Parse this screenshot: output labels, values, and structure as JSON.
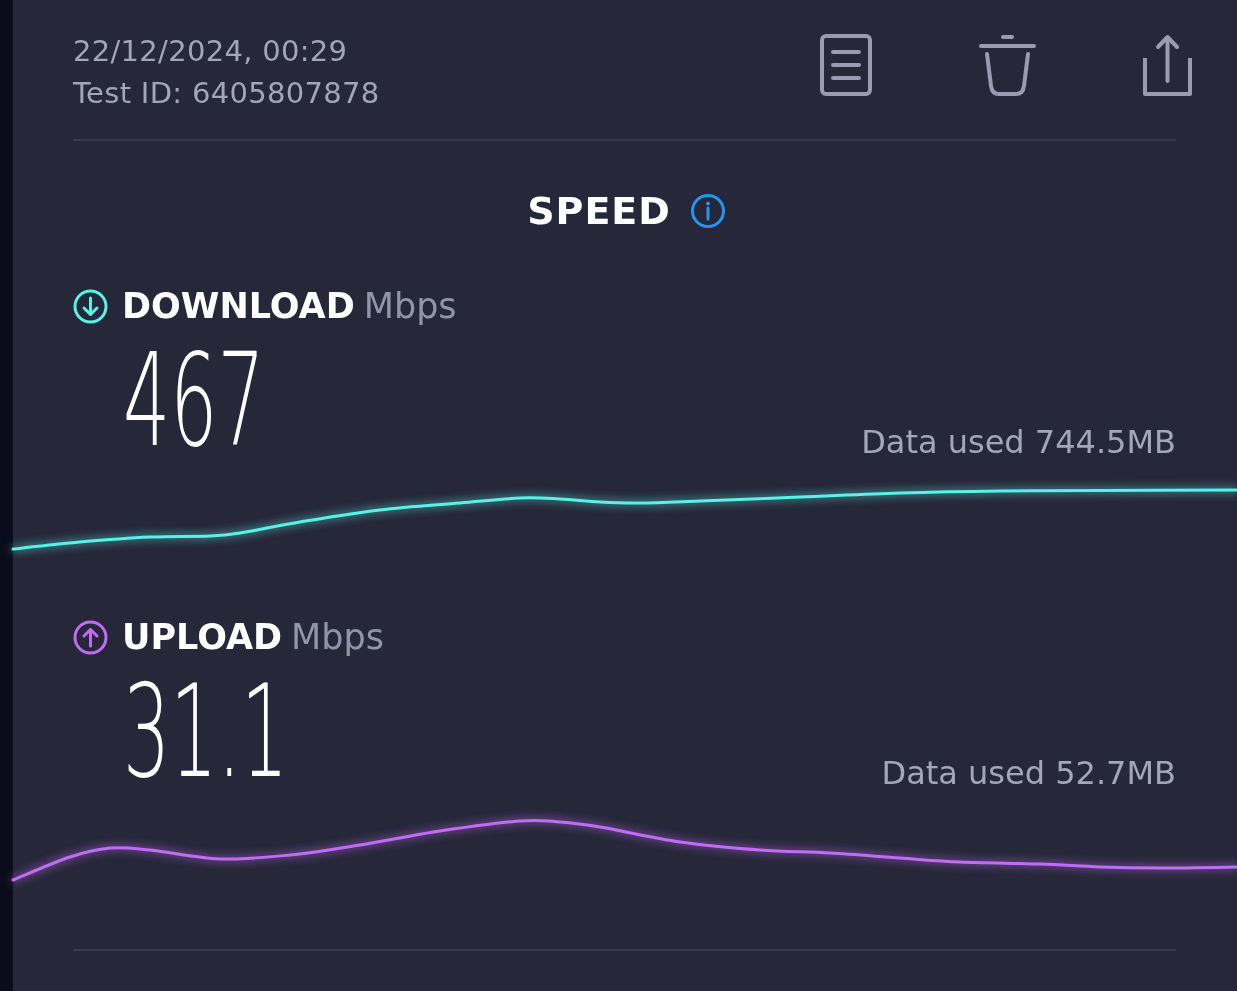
{
  "header": {
    "date_time": "22/12/2024, 00:29",
    "test_id": "Test ID: 6405807878"
  },
  "section": {
    "title": "SPEED"
  },
  "tests": [
    {
      "kind": "download",
      "label": "DOWNLOAD",
      "unit": "Mbps",
      "value": "467",
      "data_used": "Data used 744.5MB",
      "color": "#58f2e6"
    },
    {
      "kind": "upload",
      "label": "UPLOAD",
      "unit": "Mbps",
      "value": "31.1",
      "data_used": "Data used 52.7MB",
      "color": "#c06cf4"
    }
  ]
}
